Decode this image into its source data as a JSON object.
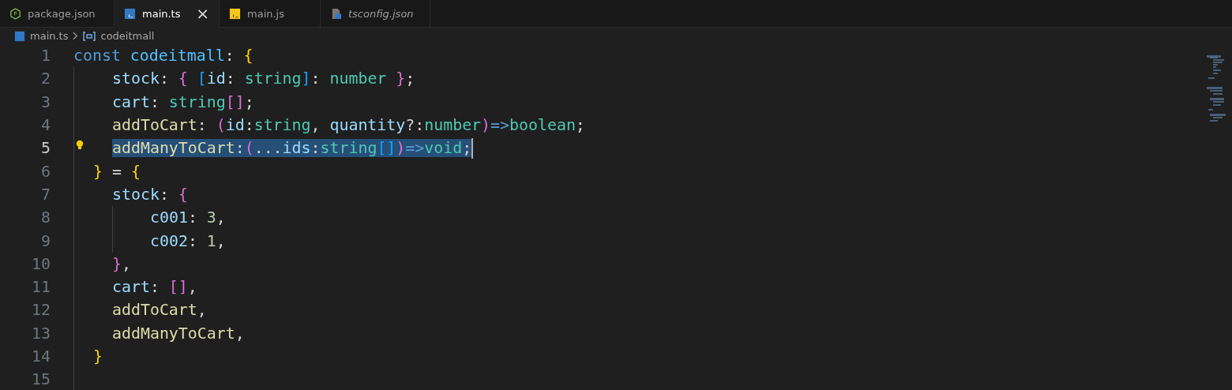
{
  "tabs": [
    {
      "label": "package.json",
      "kind": "json",
      "selected": false,
      "italic": false
    },
    {
      "label": "main.ts",
      "kind": "typescript",
      "selected": true,
      "italic": false,
      "close": "×"
    },
    {
      "label": "main.js",
      "kind": "javascript",
      "selected": false,
      "italic": false
    },
    {
      "label": "tsconfig.json",
      "kind": "config",
      "selected": false,
      "italic": true
    }
  ],
  "breadcrumb": {
    "file": "main.ts",
    "symbol": "codeitmall"
  },
  "lines": [
    {
      "number": "1",
      "current": false,
      "selected": false,
      "lightbulb": false,
      "tokens": [
        {
          "text": "const ",
          "kind": "keyword"
        },
        {
          "text": "codeitmall",
          "kind": "variable"
        },
        {
          "text": ": ",
          "kind": "punct"
        },
        {
          "text": "{",
          "kind": "bracket1"
        }
      ]
    },
    {
      "number": "2",
      "current": false,
      "selected": false,
      "lightbulb": false,
      "tokens": [
        {
          "text": "    stock",
          "kind": "property"
        },
        {
          "text": ": ",
          "kind": "punct"
        },
        {
          "text": "{",
          "kind": "bracket2"
        },
        {
          "text": " [",
          "kind": "bracket3"
        },
        {
          "text": "id",
          "kind": "property"
        },
        {
          "text": ": ",
          "kind": "punct"
        },
        {
          "text": "string",
          "kind": "type"
        },
        {
          "text": "]",
          "kind": "bracket3"
        },
        {
          "text": ": ",
          "kind": "punct"
        },
        {
          "text": "number",
          "kind": "type"
        },
        {
          "text": " }",
          "kind": "bracket2"
        },
        {
          "text": ";",
          "kind": "punct"
        }
      ]
    },
    {
      "number": "3",
      "current": false,
      "selected": false,
      "lightbulb": false,
      "tokens": [
        {
          "text": "    cart",
          "kind": "property"
        },
        {
          "text": ": ",
          "kind": "punct"
        },
        {
          "text": "string",
          "kind": "type"
        },
        {
          "text": "[]",
          "kind": "bracket2"
        },
        {
          "text": ";",
          "kind": "punct"
        }
      ]
    },
    {
      "number": "4",
      "current": false,
      "selected": false,
      "lightbulb": false,
      "tokens": [
        {
          "text": "    addToCart",
          "kind": "method"
        },
        {
          "text": ": ",
          "kind": "punct"
        },
        {
          "text": "(",
          "kind": "bracket2"
        },
        {
          "text": "id",
          "kind": "property"
        },
        {
          "text": ":",
          "kind": "punct"
        },
        {
          "text": "string",
          "kind": "type"
        },
        {
          "text": ", ",
          "kind": "punct"
        },
        {
          "text": "quantity",
          "kind": "property"
        },
        {
          "text": "?:",
          "kind": "punct"
        },
        {
          "text": "number",
          "kind": "type"
        },
        {
          "text": ")",
          "kind": "bracket2"
        },
        {
          "text": "=>",
          "kind": "keyword"
        },
        {
          "text": "boolean",
          "kind": "type"
        },
        {
          "text": ";",
          "kind": "punct"
        }
      ]
    },
    {
      "number": "5",
      "current": true,
      "selected": true,
      "lightbulb": true,
      "tokens": [
        {
          "text": "    addManyToCart",
          "kind": "method"
        },
        {
          "text": ":",
          "kind": "punct"
        },
        {
          "text": "(",
          "kind": "bracket2"
        },
        {
          "text": "...",
          "kind": "punct"
        },
        {
          "text": "ids",
          "kind": "property"
        },
        {
          "text": ":",
          "kind": "punct"
        },
        {
          "text": "string",
          "kind": "type"
        },
        {
          "text": "[]",
          "kind": "bracket3"
        },
        {
          "text": ")",
          "kind": "bracket2"
        },
        {
          "text": "=>",
          "kind": "keyword"
        },
        {
          "text": "void",
          "kind": "type"
        },
        {
          "text": ";",
          "kind": "punct"
        }
      ]
    },
    {
      "number": "6",
      "current": false,
      "selected": false,
      "lightbulb": false,
      "tokens": [
        {
          "text": "  }",
          "kind": "bracket1"
        },
        {
          "text": " = ",
          "kind": "punct"
        },
        {
          "text": "{",
          "kind": "bracket1"
        }
      ]
    },
    {
      "number": "7",
      "current": false,
      "selected": false,
      "lightbulb": false,
      "tokens": [
        {
          "text": "    stock",
          "kind": "property"
        },
        {
          "text": ": ",
          "kind": "punct"
        },
        {
          "text": "{",
          "kind": "bracket2"
        }
      ]
    },
    {
      "number": "8",
      "current": false,
      "selected": false,
      "lightbulb": false,
      "tokens": [
        {
          "text": "        c001",
          "kind": "property"
        },
        {
          "text": ": ",
          "kind": "punct"
        },
        {
          "text": "3",
          "kind": "number"
        },
        {
          "text": ",",
          "kind": "punct"
        }
      ]
    },
    {
      "number": "9",
      "current": false,
      "selected": false,
      "lightbulb": false,
      "tokens": [
        {
          "text": "        c002",
          "kind": "property"
        },
        {
          "text": ": ",
          "kind": "punct"
        },
        {
          "text": "1",
          "kind": "number"
        },
        {
          "text": ",",
          "kind": "punct"
        }
      ]
    },
    {
      "number": "10",
      "current": false,
      "selected": false,
      "lightbulb": false,
      "tokens": [
        {
          "text": "    }",
          "kind": "bracket2"
        },
        {
          "text": ",",
          "kind": "punct"
        }
      ]
    },
    {
      "number": "11",
      "current": false,
      "selected": false,
      "lightbulb": false,
      "tokens": [
        {
          "text": "    cart",
          "kind": "property"
        },
        {
          "text": ": ",
          "kind": "punct"
        },
        {
          "text": "[]",
          "kind": "bracket2"
        },
        {
          "text": ",",
          "kind": "punct"
        }
      ]
    },
    {
      "number": "12",
      "current": false,
      "selected": false,
      "lightbulb": false,
      "tokens": [
        {
          "text": "    addToCart",
          "kind": "method"
        },
        {
          "text": ",",
          "kind": "punct"
        }
      ]
    },
    {
      "number": "13",
      "current": false,
      "selected": false,
      "lightbulb": false,
      "tokens": [
        {
          "text": "    addManyToCart",
          "kind": "method"
        },
        {
          "text": ",",
          "kind": "punct"
        }
      ]
    },
    {
      "number": "14",
      "current": false,
      "selected": false,
      "lightbulb": false,
      "tokens": [
        {
          "text": "  }",
          "kind": "bracket1"
        }
      ]
    },
    {
      "number": "15",
      "current": false,
      "selected": false,
      "lightbulb": false
    }
  ]
}
